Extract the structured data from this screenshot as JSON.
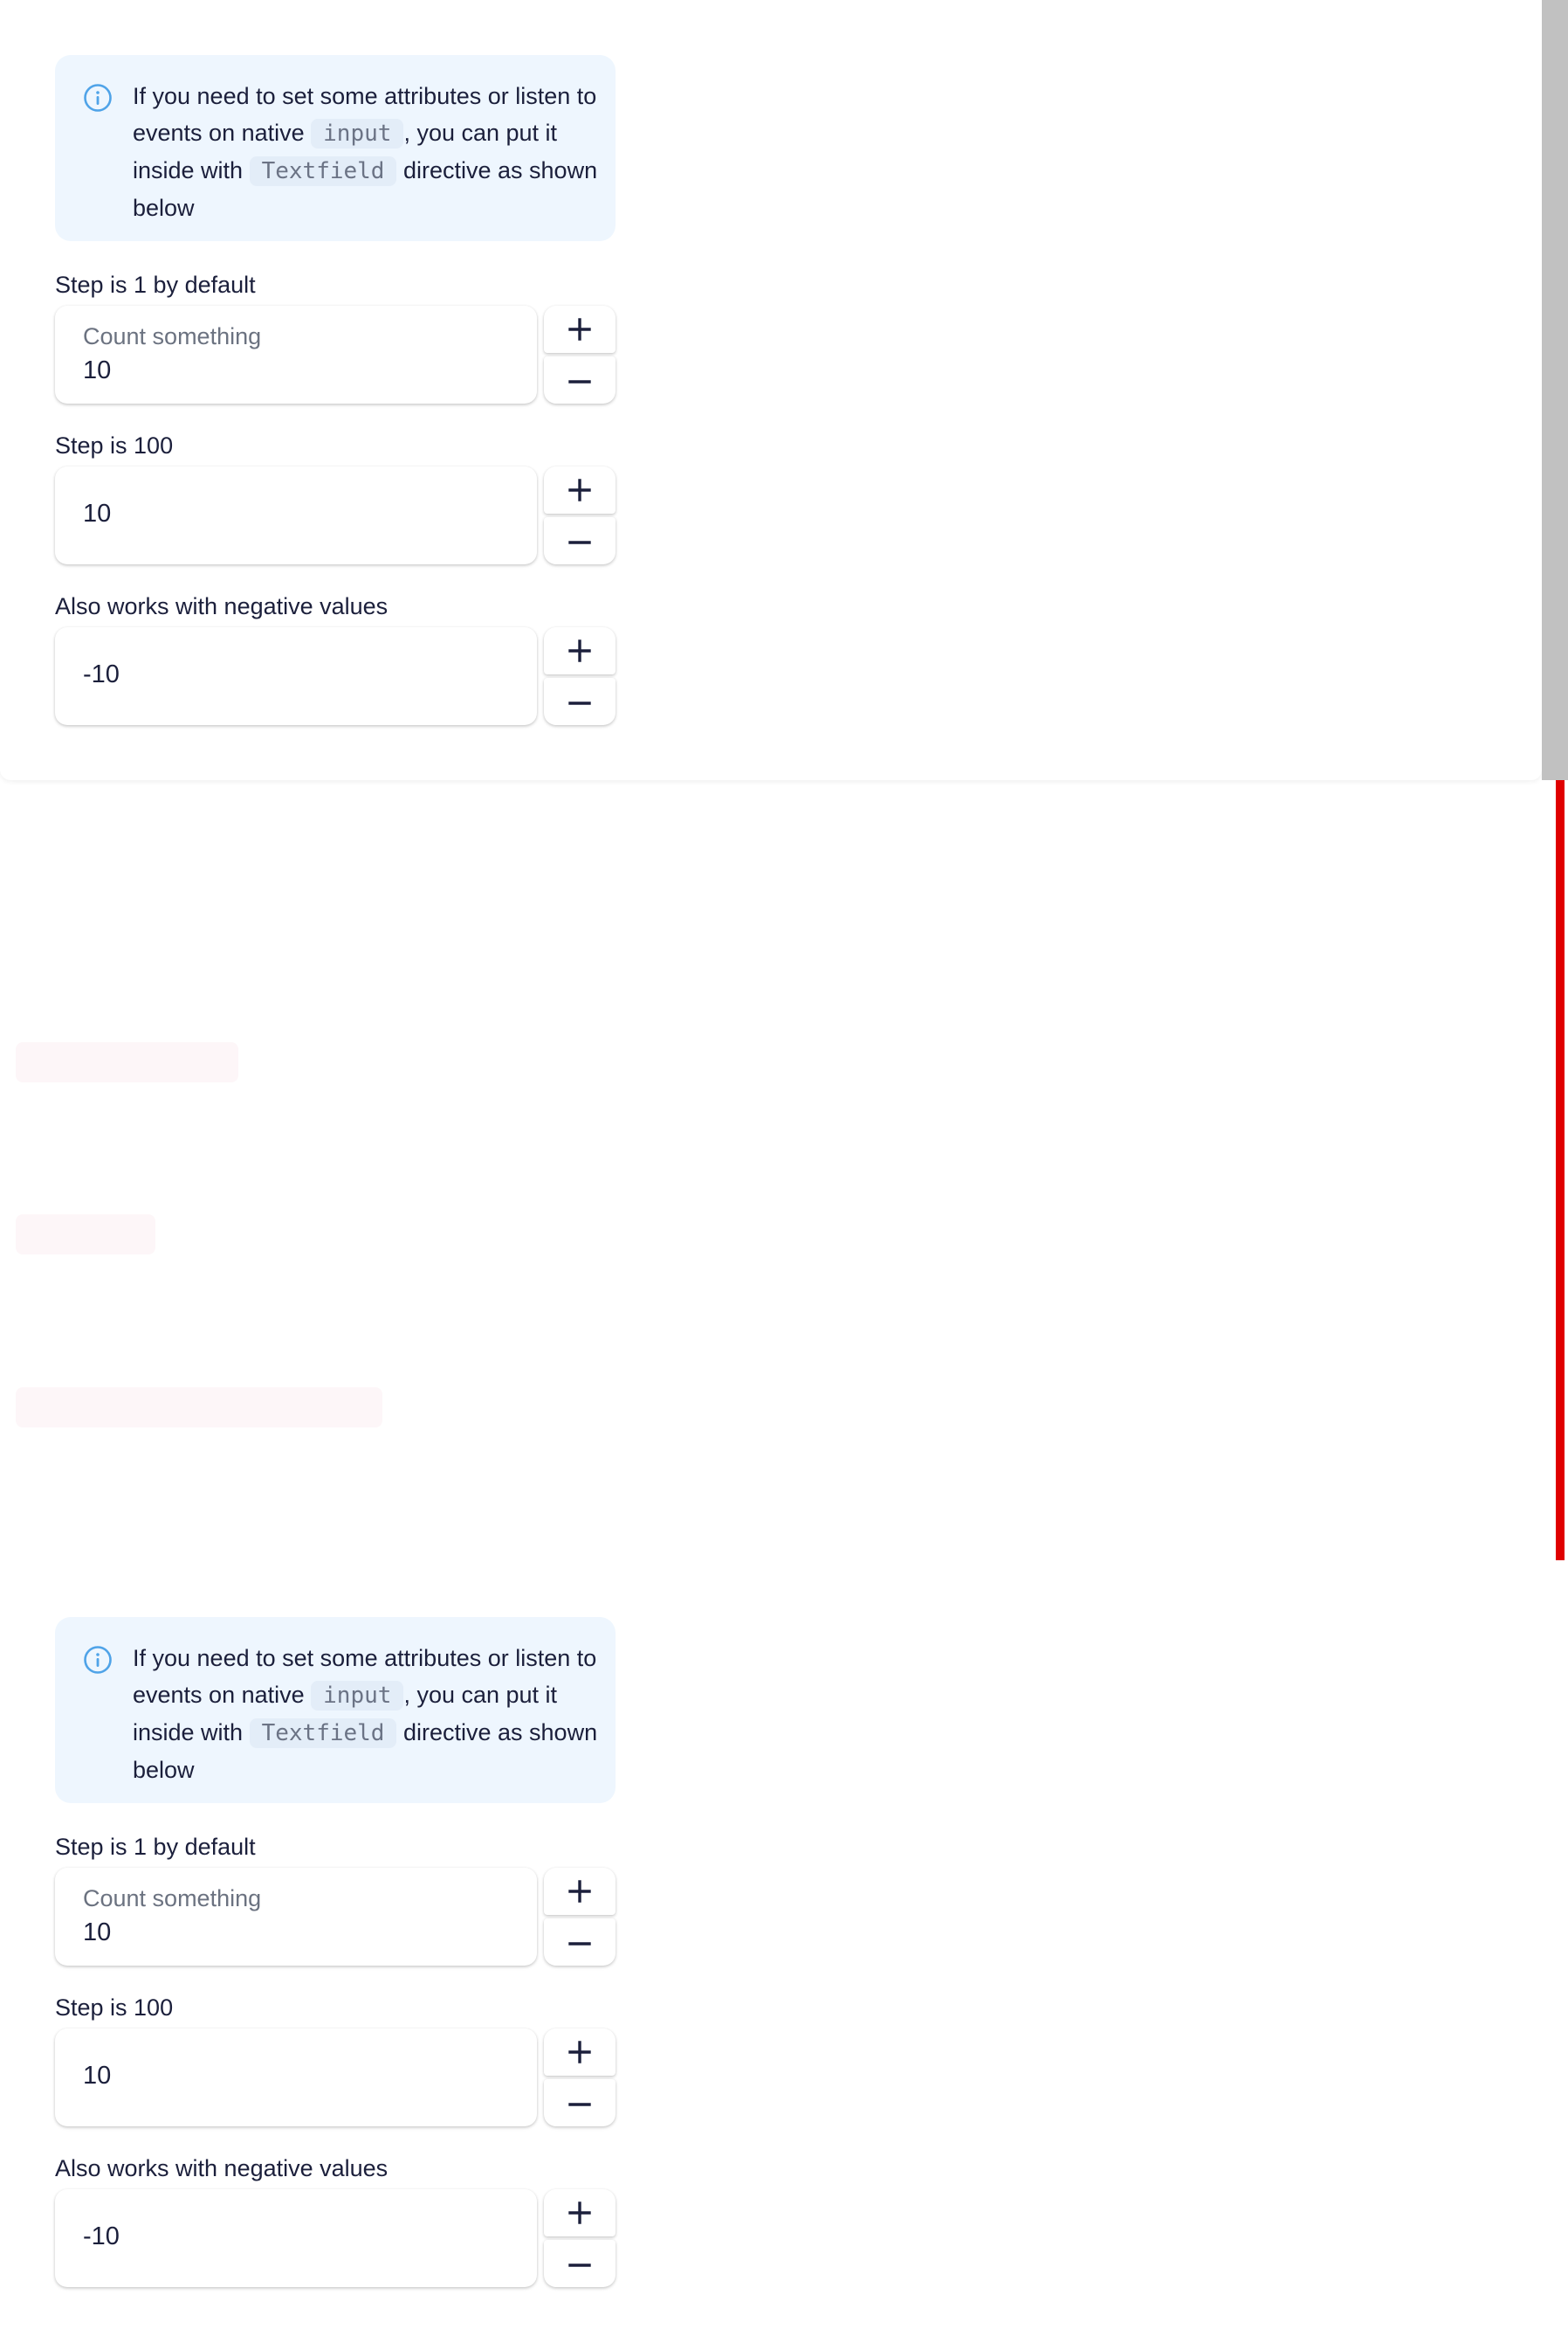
{
  "notice": {
    "part1": "If you need to set some attributes or listen to events on native",
    "code1": "input",
    "part2": ", you can put it inside with",
    "code2": "Textfield",
    "part3": "directive as shown below",
    "icon": "info-circle-icon"
  },
  "steppers": [
    {
      "caption": "Step is 1 by default",
      "label": "Count something",
      "value": "10"
    },
    {
      "caption": "Step is 100",
      "label": "",
      "value": "10"
    },
    {
      "caption": "Also works with negative values",
      "label": "",
      "value": "-10"
    }
  ],
  "buttons": {
    "increment_icon": "plus-icon",
    "decrement_icon": "minus-icon"
  },
  "colors": {
    "notice_bg": "#eef6fe",
    "info_icon": "#4fa3e8",
    "scrollbar": "#c1c1c1",
    "red_bar": "#e00000"
  }
}
